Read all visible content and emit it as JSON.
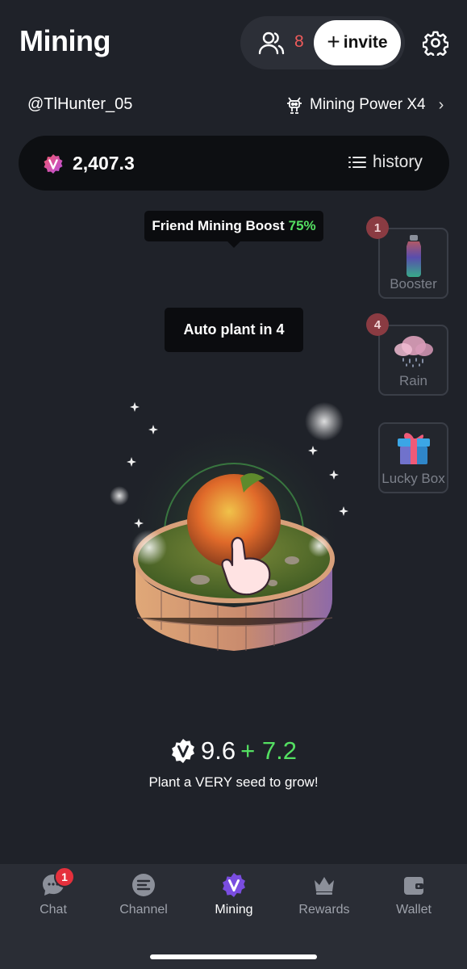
{
  "header": {
    "title": "Mining",
    "friends_count": "8",
    "invite_label": "invite"
  },
  "profile": {
    "username": "@TlHunter_05",
    "mining_power": "Mining Power X4"
  },
  "balance": {
    "value": "2,407.3",
    "history_label": "history"
  },
  "tooltips": {
    "boost_text": "Friend Mining Boost",
    "boost_pct": "75%",
    "autoplant": "Auto plant in 4"
  },
  "side_tiles": [
    {
      "label": "Booster",
      "badge": "1"
    },
    {
      "label": "Rain",
      "badge": "4"
    },
    {
      "label": "Lucky Box",
      "badge": ""
    }
  ],
  "stats": {
    "base_rate": "9.6",
    "bonus_rate": "+ 7.2",
    "hint": "Plant a VERY seed to grow!"
  },
  "nav": {
    "items": [
      {
        "label": "Chat",
        "icon": "chat-icon",
        "badge": "1"
      },
      {
        "label": "Channel",
        "icon": "channel-icon"
      },
      {
        "label": "Mining",
        "icon": "mining-icon",
        "active": true
      },
      {
        "label": "Rewards",
        "icon": "crown-icon"
      },
      {
        "label": "Wallet",
        "icon": "wallet-icon"
      }
    ]
  },
  "colors": {
    "background": "#1f2229",
    "accent_green": "#54e062",
    "accent_purple": "#7a4de0",
    "badge_red": "#e5303c",
    "friends_count_red": "#ef5b5b"
  }
}
